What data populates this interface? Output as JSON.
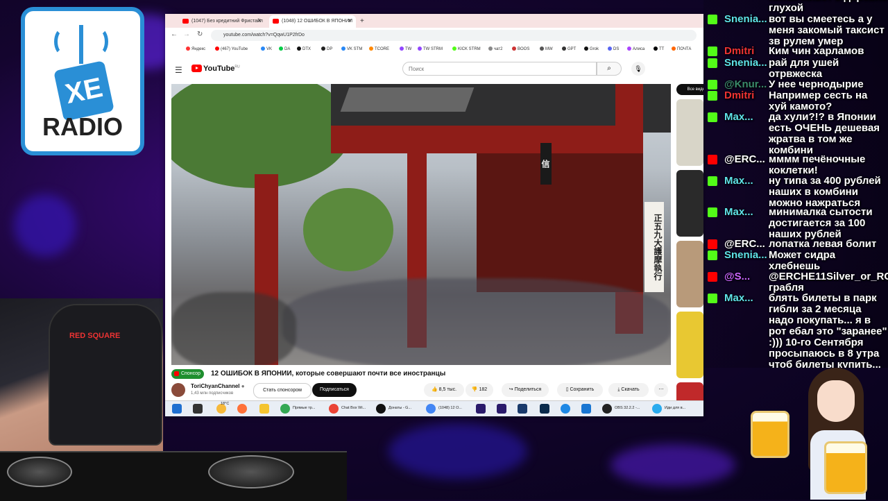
{
  "overlay": {
    "logo": {
      "top": "XE",
      "bottom": "RADIO"
    },
    "chair_brand": "RED SQUARE"
  },
  "browser": {
    "tabs": [
      {
        "label": "(1047) Без кредитний Фристайл",
        "active": false
      },
      {
        "label": "(1048) 12 ОШИБОК В ЯПОНИИ",
        "active": true
      }
    ],
    "new_tab": "+",
    "url": "youtube.com/watch?v=QqwU1P2frDo",
    "bookmarks": [
      "Яндекс",
      "(467) YouTube",
      "VK",
      "DA",
      "DTX",
      "DP",
      "VK STM",
      "TCORE",
      "TW",
      "TW STRM",
      "KICK STRM",
      "чат2",
      "BOOS",
      "MW",
      "GPT",
      "Grok",
      "DS",
      "Алиса",
      "TT",
      "ПОЧТА"
    ]
  },
  "youtube": {
    "logo_text": "YouTube",
    "logo_region": "RU",
    "search_placeholder": "Поиск",
    "sidebar_chip": "Все видео",
    "sponsor_label": "Спонсор",
    "video_title": "12 ОШИБОК В ЯПОНИИ, которые совершают почти все иностранцы",
    "channel": {
      "name": "ToriChyanChannel",
      "subscribers": "1,43 млн подписчиков"
    },
    "buttons": {
      "sponsor": "Стать спонсором",
      "subscribe": "Подписаться",
      "likes": "8,5 тыс.",
      "dislikes": "182",
      "share": "Поделиться",
      "save": "Сохранить",
      "download": "Скачать",
      "more": "⋯"
    },
    "video_signs": [
      "正五九大護摩執行",
      "信"
    ]
  },
  "taskbar": {
    "weather": "18°C",
    "items": [
      "Прямые тр...",
      "Chat Box Wi...",
      "Донаты - G...",
      "(1048) 12 О...",
      "OBS 32.2.2 -...",
      "Иди для в..."
    ],
    "time": "23:32",
    "date": "25.05.2026"
  },
  "chat": [
    {
      "platform": "kick",
      "user": "",
      "text": "Китае живет в деревне глухой"
    },
    {
      "platform": "kick",
      "user": "Snenia...",
      "text": "вот вы смеетесь а у меня закомый таксист зв рулем умер"
    },
    {
      "platform": "kick",
      "user": "Dmitri",
      "text": "Ким чин харламов"
    },
    {
      "platform": "kick",
      "user": "Snenia...",
      "text": "рай для ушей отрвжеска"
    },
    {
      "platform": "kick",
      "user": "@Knur...",
      "text": "У нее чернодырие"
    },
    {
      "platform": "kick",
      "user": "Dmitri",
      "text": "Например сесть на хуй камото?"
    },
    {
      "platform": "kick",
      "user": "Max...",
      "text": "да хули?!? в Японии есть ОЧЕНЬ дешевая жратва в том же комбини"
    },
    {
      "platform": "youtube",
      "user": "@ERC...",
      "text": "мммм печёночные коклетки!"
    },
    {
      "platform": "kick",
      "user": "Max...",
      "text": "ну типа за 400 рублей наших в комбини можно нажраться"
    },
    {
      "platform": "kick",
      "user": "Max...",
      "text": "минималка сытости достигается за 100 наших рублей"
    },
    {
      "platform": "youtube",
      "user": "@ERC...",
      "text": "лопатка левая болит"
    },
    {
      "platform": "kick",
      "user": "Snenia...",
      "text": "Может сидра хлебнешь"
    },
    {
      "platform": "youtube",
      "user": "@S...",
      "text": "@ERCHE11Silver_or_RCS грабля"
    },
    {
      "platform": "kick",
      "user": "Max...",
      "text": "блять билеты в парк гибли за 2 месяца надо покупать... я в рот ебал это \"заранее\" :))) 10-го Сентября просыпаюсь в 8 утра чтоб билеты купить..."
    }
  ]
}
